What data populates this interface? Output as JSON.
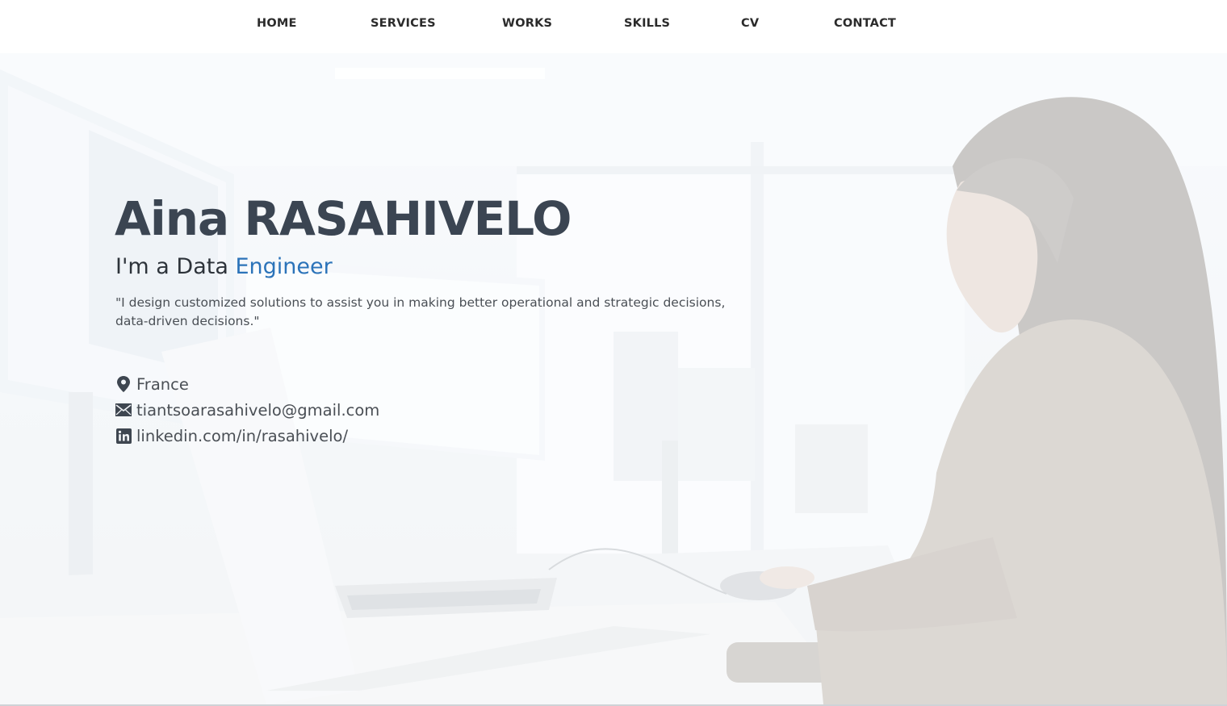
{
  "nav": {
    "items": [
      {
        "label": "HOME"
      },
      {
        "label": "SERVICES"
      },
      {
        "label": "WORKS"
      },
      {
        "label": "SKILLS"
      },
      {
        "label": "CV"
      },
      {
        "label": "CONTACT"
      }
    ]
  },
  "hero": {
    "name": "Aina RASAHIVELO",
    "subtitle_prefix": "I'm a Data ",
    "subtitle_accent": "Engineer",
    "quote_line1": "\"I design customized solutions to assist you in making better operational and strategic decisions,",
    "quote_line2": "data-driven decisions.\"",
    "background_image": "office-woman-at-computer-photo"
  },
  "contact": {
    "location": "France",
    "email": "tiantsoarasahivelo@gmail.com",
    "linkedin": "linkedin.com/in/rasahivelo/",
    "icons": {
      "location": "map-pin-icon",
      "email": "envelope-icon",
      "linkedin": "linkedin-icon"
    }
  },
  "colors": {
    "accent": "#2b73b9",
    "text": "#3b4552",
    "nav_text": "#2b2b2b"
  }
}
